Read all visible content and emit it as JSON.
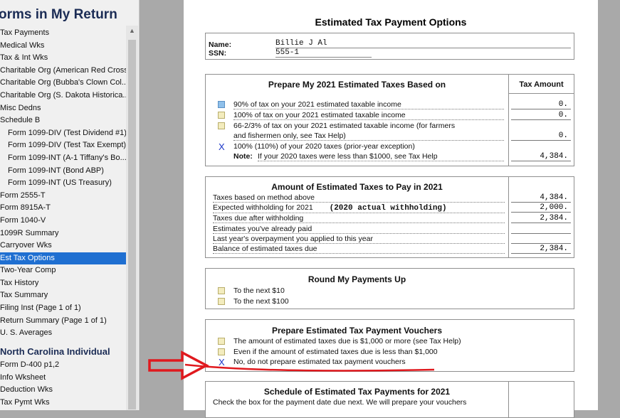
{
  "sidebar": {
    "title": "orms in My Return",
    "items": [
      {
        "label": "Tax Payments"
      },
      {
        "label": "Medical Wks"
      },
      {
        "label": "Tax & Int Wks"
      },
      {
        "label": "Charitable Org (American Red Cross)"
      },
      {
        "label": "Charitable Org (Bubba's Clown Col..."
      },
      {
        "label": "Charitable Org (S. Dakota Historica..."
      },
      {
        "label": "Misc Dedns"
      },
      {
        "label": "Schedule B"
      },
      {
        "label": "Form 1099-DIV (Test Dividend #1)"
      },
      {
        "label": "Form 1099-DIV (Test Tax Exempt)"
      },
      {
        "label": "Form 1099-INT (A-1 Tiffany's Bo..."
      },
      {
        "label": "Form 1099-INT (Bond ABP)"
      },
      {
        "label": "Form 1099-INT (US Treasury)"
      },
      {
        "label": "Form 2555-T"
      },
      {
        "label": "Form 8915A-T"
      },
      {
        "label": "Form 1040-V"
      },
      {
        "label": "1099R Summary"
      },
      {
        "label": "Carryover Wks"
      },
      {
        "label": "Est Tax Options"
      },
      {
        "label": "Two-Year Comp"
      },
      {
        "label": "Tax History"
      },
      {
        "label": "Tax Summary"
      },
      {
        "label": "Filing Inst (Page 1 of 1)"
      },
      {
        "label": "Return Summary (Page 1 of 1)"
      },
      {
        "label": "U. S. Averages"
      }
    ],
    "section_title": "North Carolina Individual",
    "section_items": [
      {
        "label": "Form D-400 p1,2"
      },
      {
        "label": "Info Wksheet"
      },
      {
        "label": "Deduction Wks"
      },
      {
        "label": "Tax Pymt Wks"
      }
    ]
  },
  "form": {
    "title": "Estimated Tax Payment Options",
    "name_label": "Name:",
    "ssn_label": "SSN:",
    "name_value": "Billie J Al",
    "ssn_value": "555-1",
    "section1": {
      "heading": "Prepare My 2021 Estimated Taxes Based on",
      "col_heading": "Tax Amount",
      "opt1": "90% of tax on your 2021 estimated taxable income",
      "opt2": "100% of tax on your 2021 estimated taxable income",
      "opt3a": "66-2/3% of tax on your 2021 estimated taxable income (for farmers",
      "opt3b": "and fishermen only, see Tax Help)",
      "opt4": "100% (110%) of your 2020 taxes (prior-year exception)",
      "note_label": "Note:",
      "note_text": "If your 2020 taxes were less than $1000, see Tax Help",
      "val1": "0.",
      "val2": "0.",
      "val3": "0.",
      "val4": "4,384."
    },
    "section2": {
      "heading": "Amount of Estimated Taxes to Pay in 2021",
      "row1": "Taxes based on method above",
      "row2": "Expected withholding for 2021",
      "row2_note": "(2020 actual withholding)",
      "row3": "Taxes due after withholding",
      "row4": "Estimates you've already paid",
      "row5": "Last year's overpayment you applied to this year",
      "row6": "Balance of estimated taxes due",
      "val1": "4,384.",
      "val2": "2,000.",
      "val3": "2,384.",
      "val6": "2,384."
    },
    "section3": {
      "heading": "Round My Payments Up",
      "opt1": "To the next $10",
      "opt2": "To the next $100"
    },
    "section4": {
      "heading": "Prepare Estimated Tax Payment Vouchers",
      "opt1": "The amount of estimated taxes due is $1,000 or more (see Tax Help)",
      "opt2": "Even if the amount of estimated taxes due is less than $1,000",
      "opt3": "No, do not prepare estimated tax payment vouchers"
    },
    "section5": {
      "heading": "Schedule of Estimated Tax Payments for 2021",
      "text": "Check the box for the payment date due next. We will prepare your vouchers"
    },
    "checked_mark": "X"
  },
  "colors": {
    "selected": "#1f6fd1",
    "annotation_arrow": "#e0191e",
    "checkbox_fill": "#f3ecbe",
    "checkmark": "#1a35c8"
  }
}
